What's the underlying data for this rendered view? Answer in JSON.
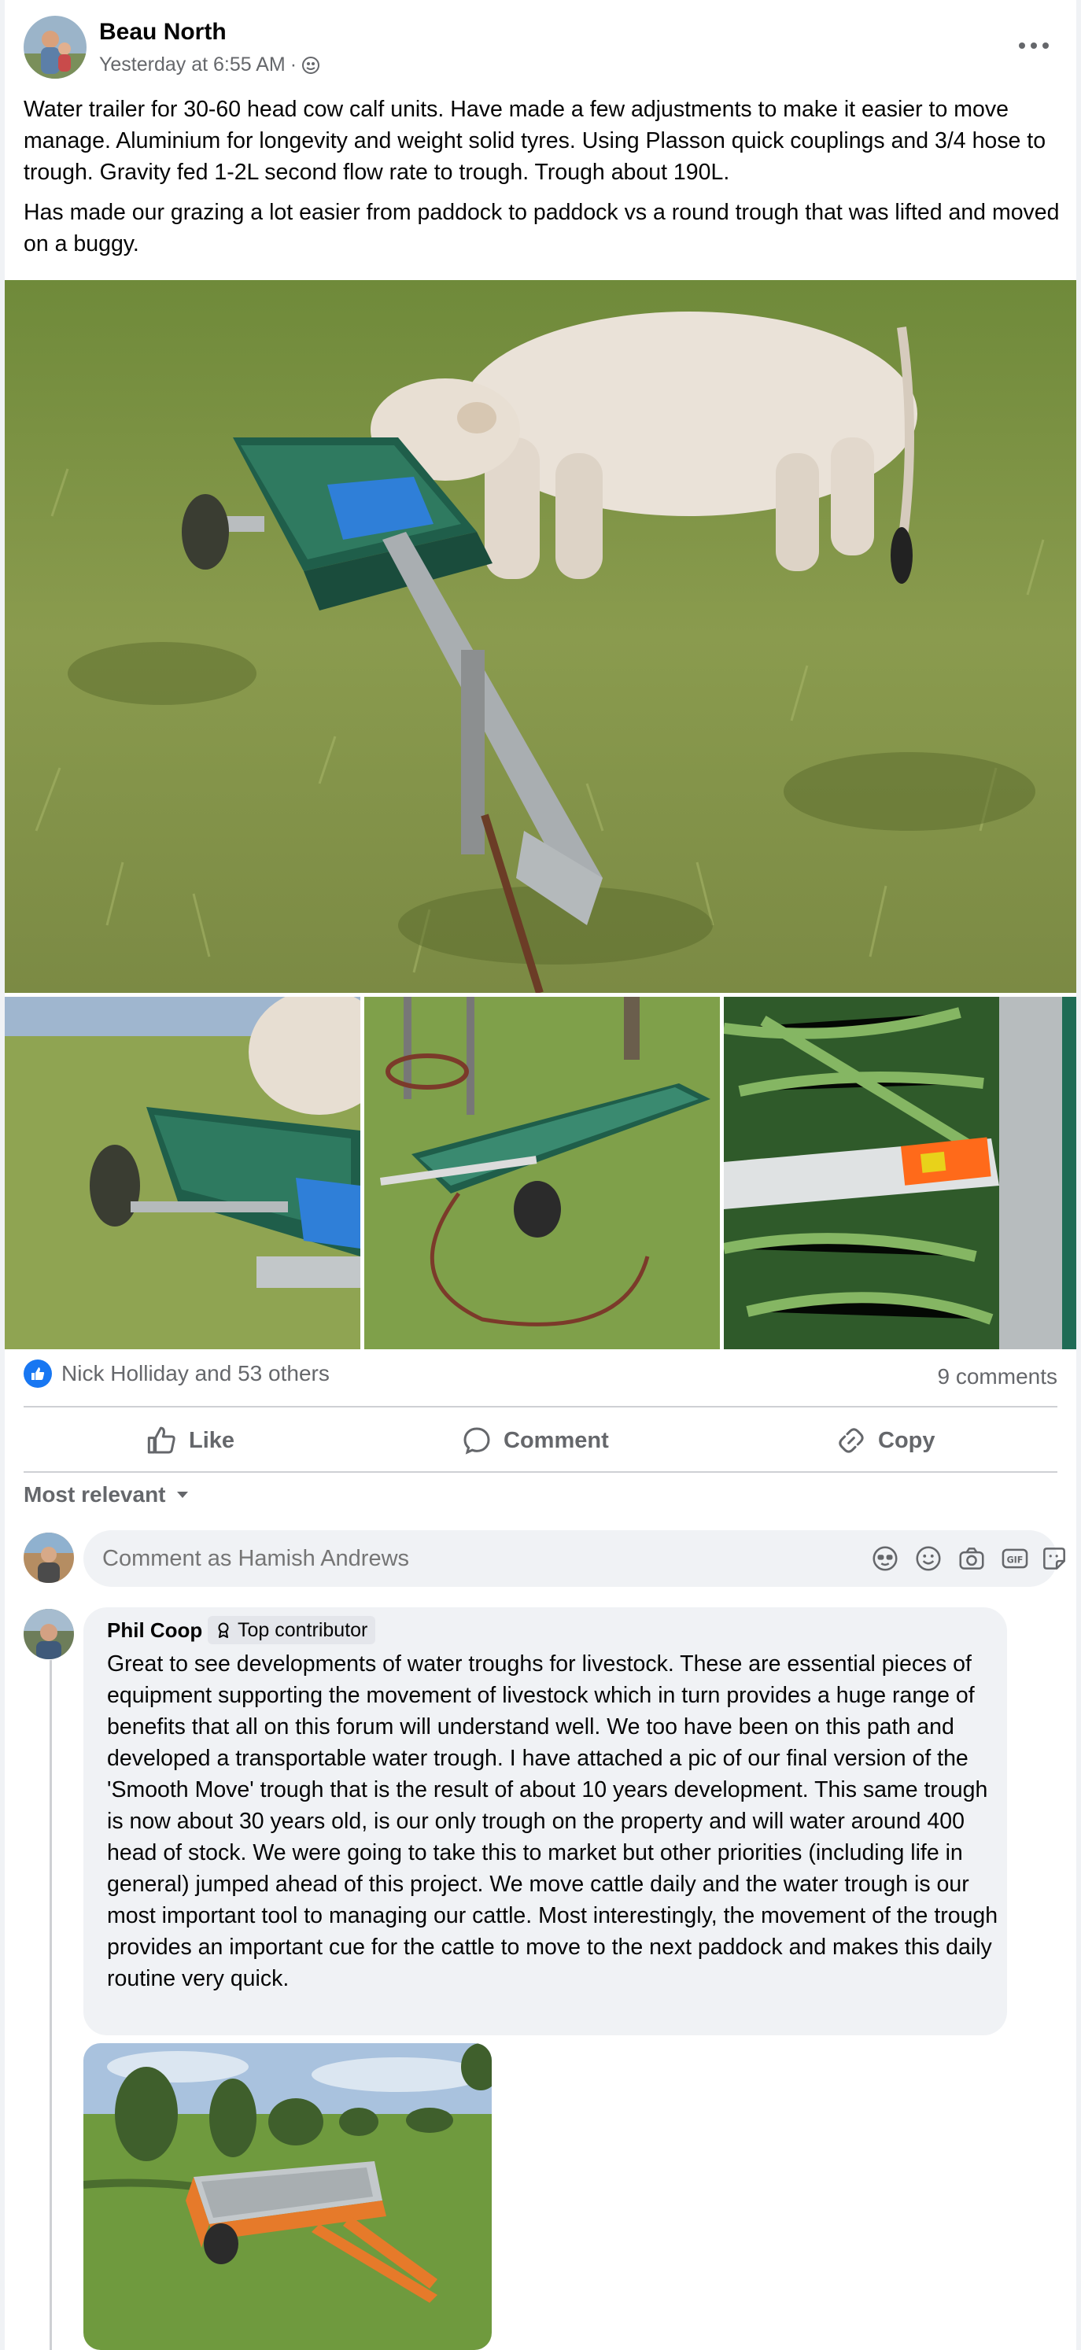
{
  "post": {
    "author": "Beau North",
    "timestamp": "Yesterday at 6:55 AM",
    "separator": "·",
    "audience_icon": "friends-globe-icon",
    "more_icon": "more-horizontal-icon",
    "paragraph1": "Water trailer for 30-60 head cow calf units. Have made a few adjustments to make it easier to move manage. Aluminium for longevity and weight solid tyres. Using Plasson quick couplings and 3/4 hose to trough. Gravity fed 1-2L second flow rate to trough. Trough about 190L.",
    "paragraph2": "Has made our grazing a lot easier from paddock to paddock vs a round trough that was lifted and moved on a buggy."
  },
  "reactions": {
    "summary": "Nick Holliday and 53 others",
    "comments": "9 comments",
    "icon": "thumbs-up-icon"
  },
  "actions": {
    "like": "Like",
    "comment": "Comment",
    "copy": "Copy"
  },
  "sort": {
    "label": "Most relevant",
    "icon": "caret-down-icon"
  },
  "composer": {
    "placeholder": "Comment as Hamish Andrews",
    "icons": [
      "avatar-sticker-icon",
      "emoji-icon",
      "camera-icon",
      "gif-icon",
      "sticker-icon"
    ]
  },
  "comment": {
    "author": "Phil Coop",
    "badge": "Top contributor",
    "badge_icon": "award-icon",
    "text": "Great to see developments of water troughs for livestock. These are essential pieces of equipment supporting the movement of livestock which in turn provides a huge range of benefits that all on this forum will understand well. We too have been on this path and developed a transportable water trough. I have attached a pic of our final version of the 'Smooth Move' trough that is the result of about 10 years development. This same trough is now about 30 years old, is our only trough on the property and will water around 400 head of stock. We were going to take this to market but other priorities (including life in general) jumped ahead of this project. We move cattle daily and the water trough is our most important tool to managing our cattle. Most interestingly, the movement of the trough provides an important cue for the cattle to move to the next paddock and makes this daily routine very quick."
  },
  "colors": {
    "accent": "#1877f2",
    "secondary_text": "#65676b",
    "bubble": "#f0f2f5",
    "trough_green": "#1f5e4a"
  }
}
